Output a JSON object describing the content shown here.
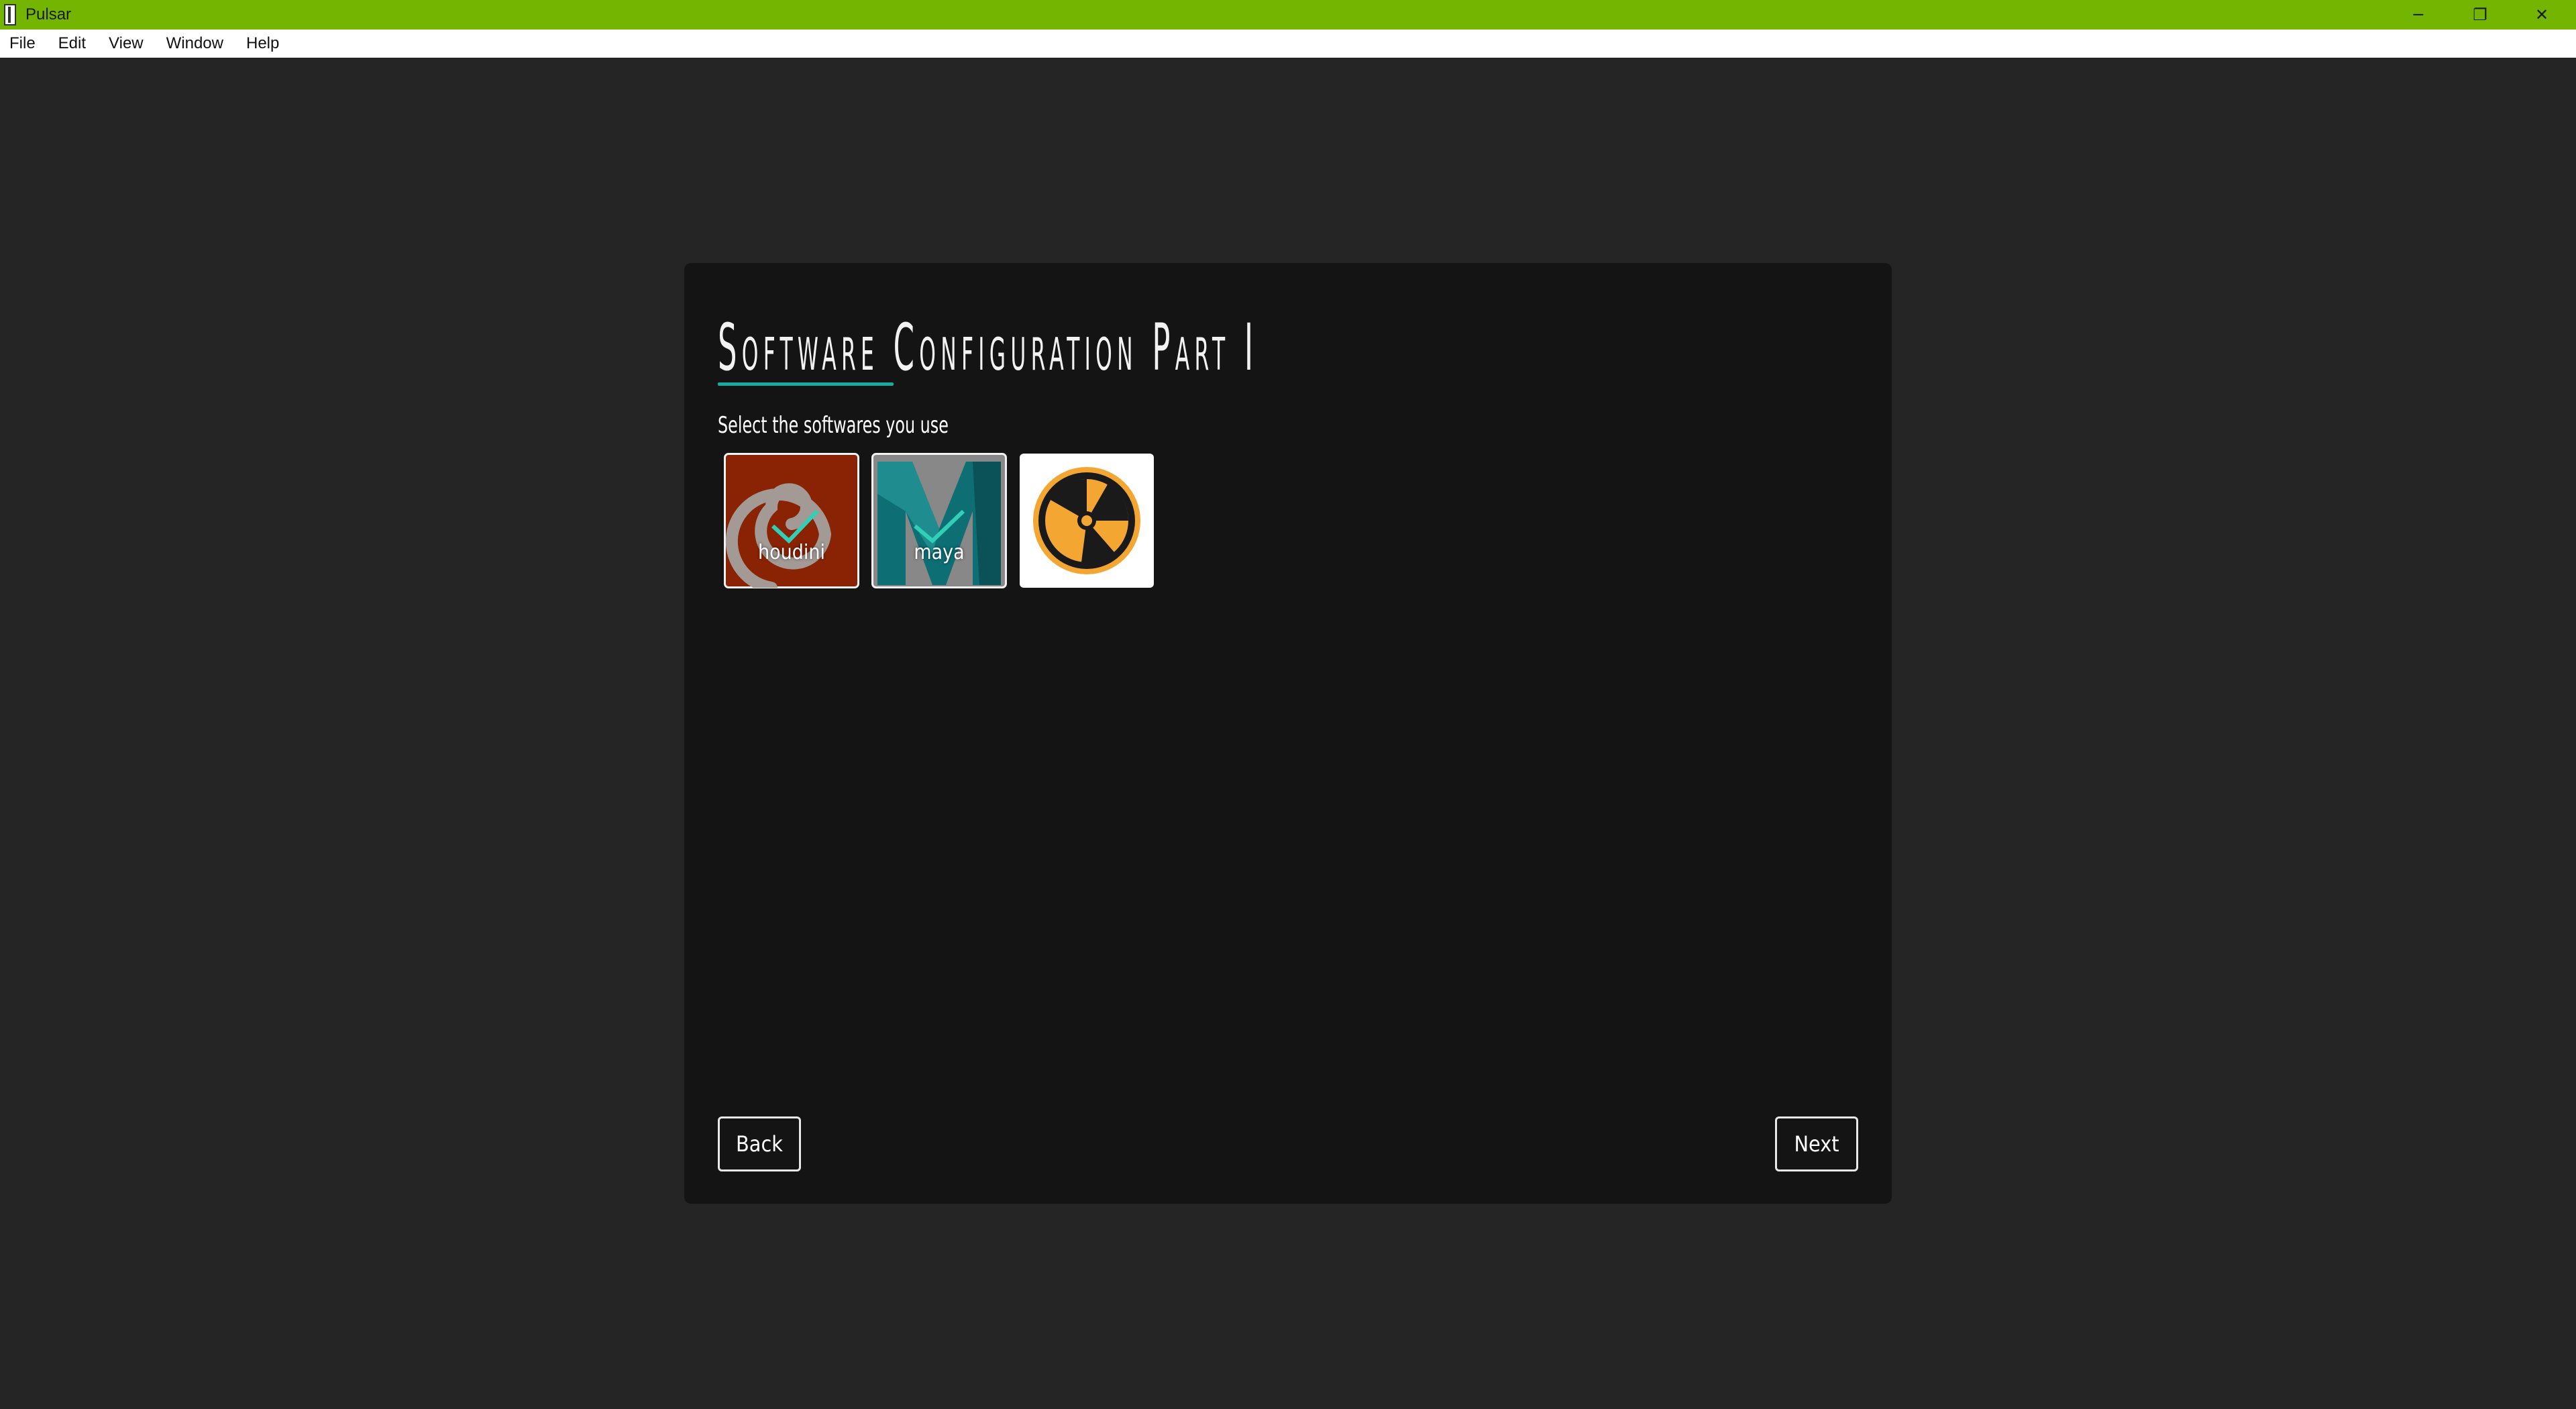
{
  "window": {
    "title": "Pulsar",
    "controls": {
      "minimize": "─",
      "maximize": "❐",
      "close": "✕"
    },
    "accent_color": "#73b500"
  },
  "menubar": {
    "items": [
      {
        "label": "File"
      },
      {
        "label": "Edit"
      },
      {
        "label": "View"
      },
      {
        "label": "Window"
      },
      {
        "label": "Help"
      }
    ]
  },
  "page": {
    "heading": "Software Configuration Part I",
    "heading_underline_color": "#1aaba0",
    "subheading": "Select the softwares you use",
    "softwares": [
      {
        "label": "houdini",
        "icon": "houdini-logo-icon",
        "selected": true,
        "bg": "#8a2304"
      },
      {
        "label": "maya",
        "icon": "maya-logo-icon",
        "selected": true,
        "bg": "#888888"
      },
      {
        "label": "",
        "icon": "nuke-logo-icon",
        "selected": false,
        "bg": "#ffffff"
      }
    ],
    "check_color": "#2fd0b5",
    "back_label": "Back",
    "next_label": "Next"
  }
}
